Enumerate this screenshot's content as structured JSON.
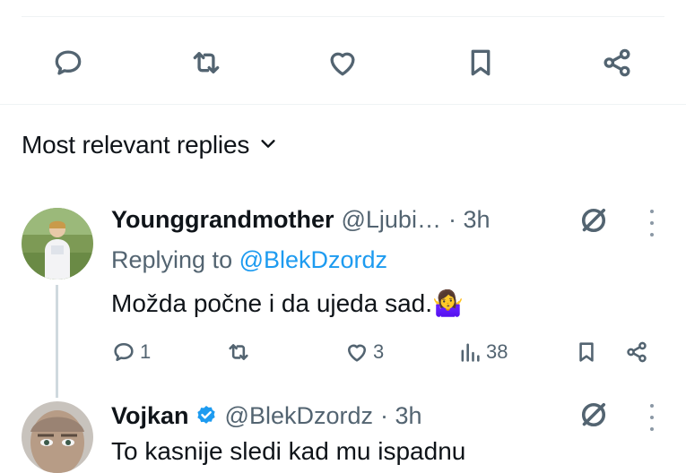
{
  "tweet_actions": {
    "reply_icon": "speech-bubble-icon",
    "retweet_icon": "retweet-icon",
    "like_icon": "heart-icon",
    "bookmark_icon": "bookmark-icon",
    "share_icon": "share-icon"
  },
  "replies_header": {
    "label": "Most relevant replies",
    "icon": "chevron-down-icon"
  },
  "replies": [
    {
      "display_name": "Younggrandmother",
      "handle": "@Ljubi…",
      "time": "· 3h",
      "replying_prefix": "Replying to ",
      "replying_to": "@BlekDzordz",
      "text": "Možda počne i da ujeda sad.🤷‍♀️",
      "stats": {
        "replies": "1",
        "retweets": "",
        "likes": "3",
        "views": "38"
      }
    },
    {
      "display_name": "Vojkan",
      "verified": true,
      "handle": "@BlekDzordz",
      "time": "· 3h",
      "text": "To kasnije sledi kad mu ispadnu"
    }
  ],
  "colors": {
    "text_primary": "#0f1419",
    "text_secondary": "#536471",
    "accent": "#1d9bf0",
    "divider": "#eff3f4"
  }
}
